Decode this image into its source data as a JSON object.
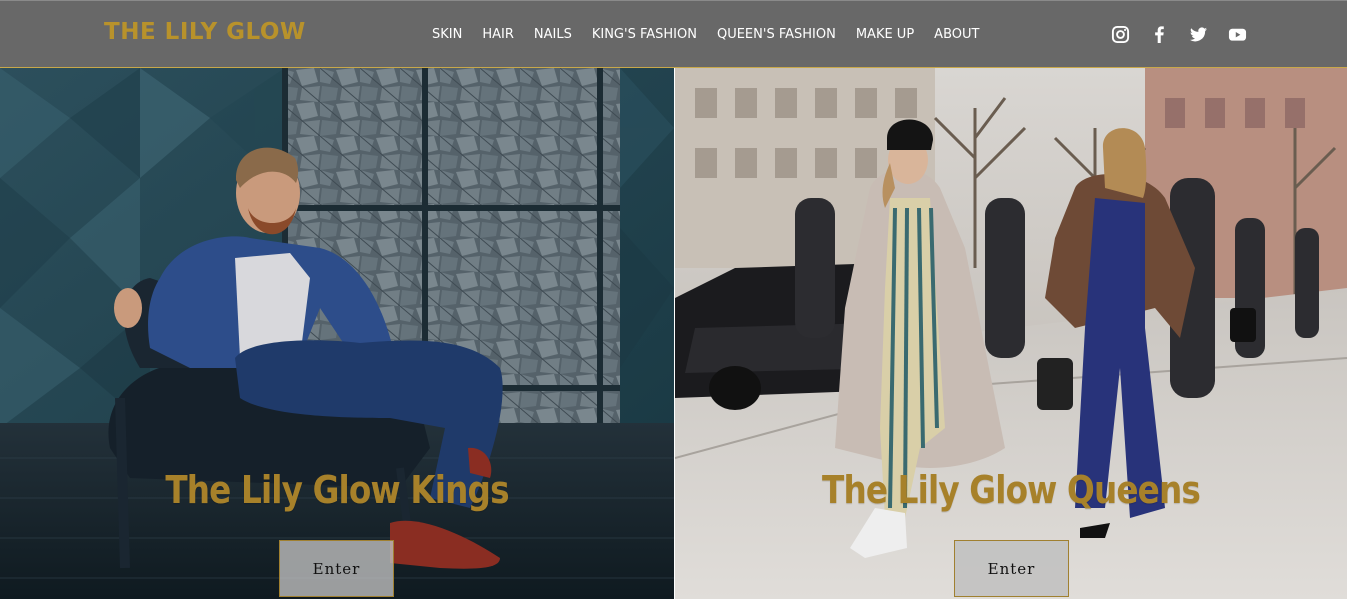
{
  "header": {
    "logo": "THE LILY GLOW",
    "nav": [
      "SKIN",
      "HAIR",
      "NAILS",
      "KING'S FASHION",
      "QUEEN'S FASHION",
      "MAKE UP",
      "ABOUT"
    ],
    "social_icons": [
      "instagram-icon",
      "facebook-icon",
      "twitter-icon",
      "youtube-icon"
    ]
  },
  "kings": {
    "title": "The Lily Glow Kings",
    "button": "Enter"
  },
  "queens": {
    "title": "The Lily Glow Queens",
    "button": "Enter"
  },
  "colors": {
    "header_bg": "#686868",
    "accent_gold": "#b8922b",
    "title_gold": "#a7812a",
    "divider": "#c8a84a"
  }
}
